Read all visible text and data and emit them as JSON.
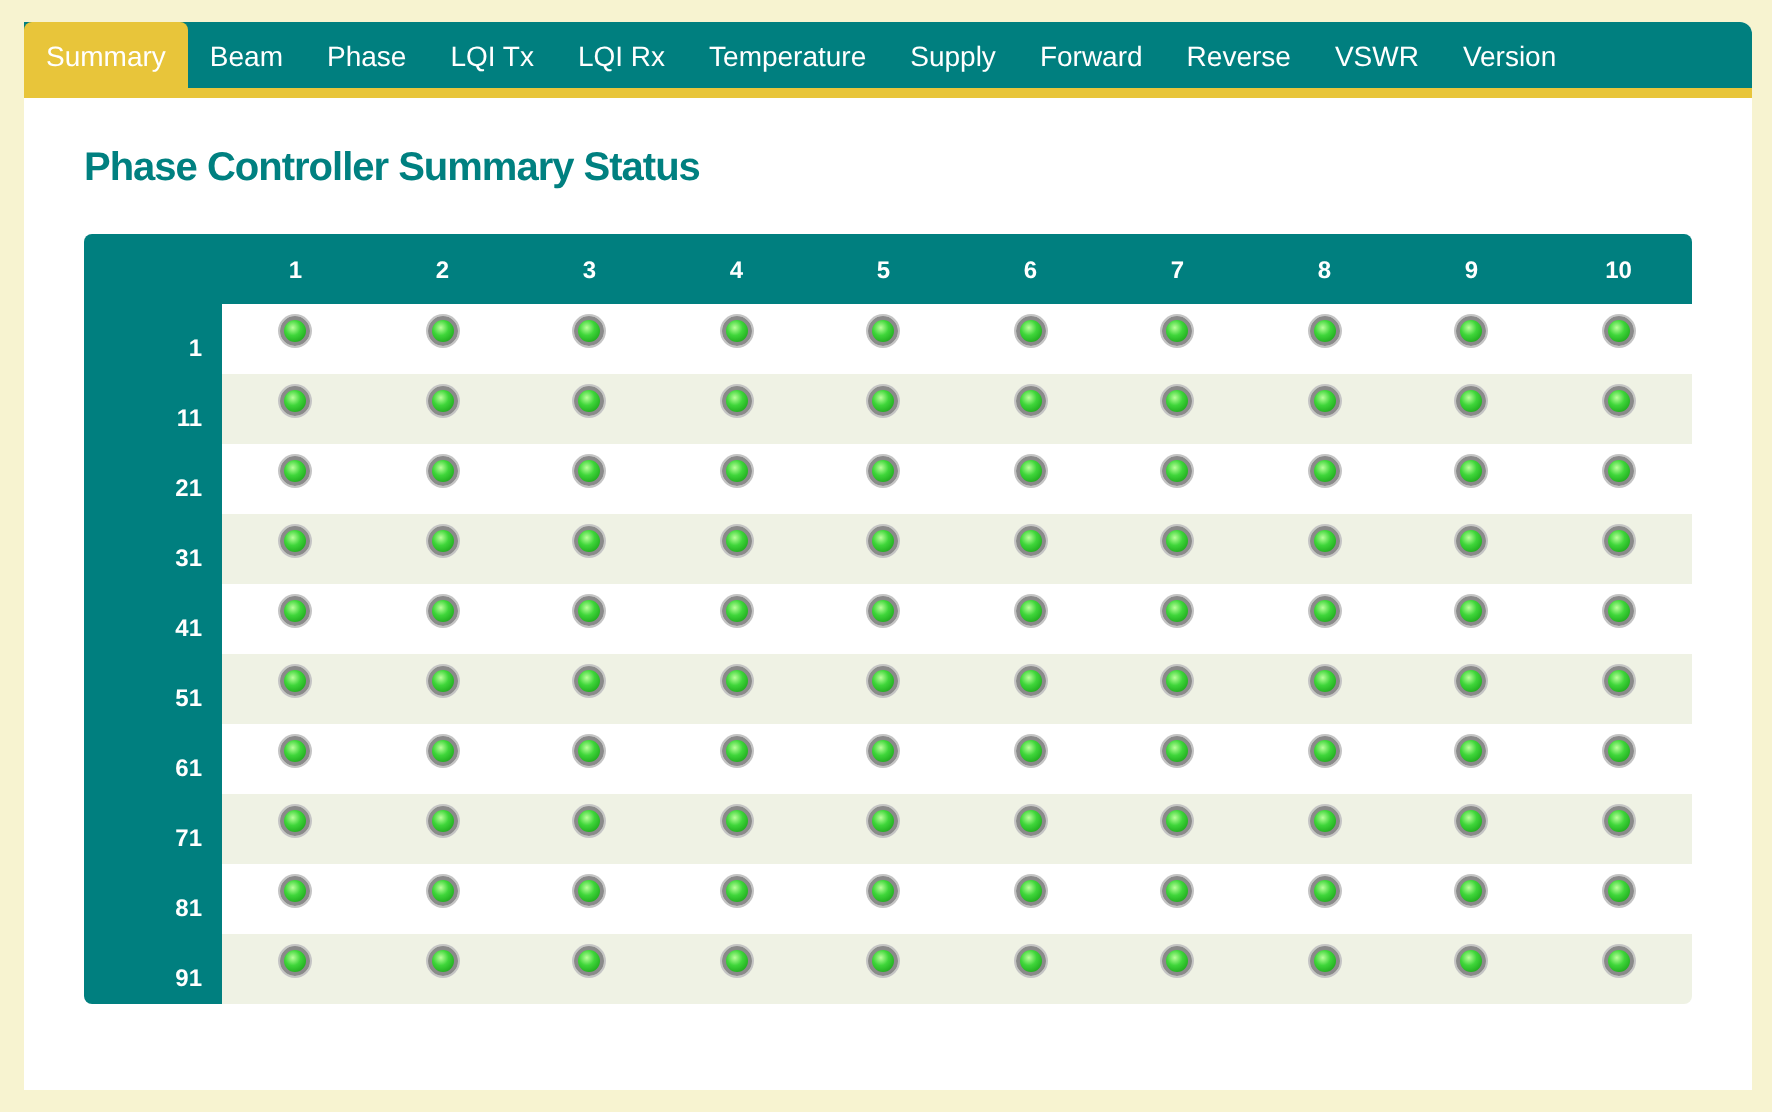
{
  "tabs": [
    {
      "label": "Summary",
      "selected": true
    },
    {
      "label": "Beam",
      "selected": false
    },
    {
      "label": "Phase",
      "selected": false
    },
    {
      "label": "LQI Tx",
      "selected": false
    },
    {
      "label": "LQI Rx",
      "selected": false
    },
    {
      "label": "Temperature",
      "selected": false
    },
    {
      "label": "Supply",
      "selected": false
    },
    {
      "label": "Forward",
      "selected": false
    },
    {
      "label": "Reverse",
      "selected": false
    },
    {
      "label": "VSWR",
      "selected": false
    },
    {
      "label": "Version",
      "selected": false
    }
  ],
  "title": "Phase Controller Summary Status",
  "table": {
    "columns": [
      "1",
      "2",
      "3",
      "4",
      "5",
      "6",
      "7",
      "8",
      "9",
      "10"
    ],
    "rows": [
      {
        "label": "1",
        "leds": [
          {
            "on": true
          },
          {
            "on": true
          },
          {
            "on": true
          },
          {
            "on": true
          },
          {
            "on": true
          },
          {
            "on": true
          },
          {
            "on": true
          },
          {
            "on": true
          },
          {
            "on": true
          },
          {
            "on": true
          }
        ]
      },
      {
        "label": "11",
        "leds": [
          {
            "on": true
          },
          {
            "on": true
          },
          {
            "on": true
          },
          {
            "on": true
          },
          {
            "on": true
          },
          {
            "on": true
          },
          {
            "on": true
          },
          {
            "on": true
          },
          {
            "on": true
          },
          {
            "on": true
          }
        ]
      },
      {
        "label": "21",
        "leds": [
          {
            "on": true
          },
          {
            "on": true
          },
          {
            "on": true
          },
          {
            "on": true
          },
          {
            "on": true
          },
          {
            "on": true
          },
          {
            "on": true
          },
          {
            "on": true
          },
          {
            "on": true
          },
          {
            "on": true
          }
        ]
      },
      {
        "label": "31",
        "leds": [
          {
            "on": true
          },
          {
            "on": true
          },
          {
            "on": true
          },
          {
            "on": true
          },
          {
            "on": true
          },
          {
            "on": true
          },
          {
            "on": true
          },
          {
            "on": true
          },
          {
            "on": true
          },
          {
            "on": true
          }
        ]
      },
      {
        "label": "41",
        "leds": [
          {
            "on": true
          },
          {
            "on": true
          },
          {
            "on": true
          },
          {
            "on": true
          },
          {
            "on": true
          },
          {
            "on": true
          },
          {
            "on": true
          },
          {
            "on": true
          },
          {
            "on": true
          },
          {
            "on": true
          }
        ]
      },
      {
        "label": "51",
        "leds": [
          {
            "on": true
          },
          {
            "on": true
          },
          {
            "on": true
          },
          {
            "on": true
          },
          {
            "on": true
          },
          {
            "on": true
          },
          {
            "on": true
          },
          {
            "on": true
          },
          {
            "on": true
          },
          {
            "on": true
          }
        ]
      },
      {
        "label": "61",
        "leds": [
          {
            "on": true
          },
          {
            "on": true
          },
          {
            "on": true
          },
          {
            "on": true
          },
          {
            "on": true
          },
          {
            "on": true
          },
          {
            "on": true
          },
          {
            "on": true
          },
          {
            "on": true
          },
          {
            "on": true
          }
        ]
      },
      {
        "label": "71",
        "leds": [
          {
            "on": true
          },
          {
            "on": true
          },
          {
            "on": true
          },
          {
            "on": true
          },
          {
            "on": true
          },
          {
            "on": true
          },
          {
            "on": true
          },
          {
            "on": true
          },
          {
            "on": true
          },
          {
            "on": true
          }
        ]
      },
      {
        "label": "81",
        "leds": [
          {
            "on": true
          },
          {
            "on": true
          },
          {
            "on": true
          },
          {
            "on": true
          },
          {
            "on": true
          },
          {
            "on": true
          },
          {
            "on": true
          },
          {
            "on": true
          },
          {
            "on": true
          },
          {
            "on": true
          }
        ]
      },
      {
        "label": "91",
        "leds": [
          {
            "on": true
          },
          {
            "on": true
          },
          {
            "on": true
          },
          {
            "on": true
          },
          {
            "on": true
          },
          {
            "on": true
          },
          {
            "on": true
          },
          {
            "on": true
          },
          {
            "on": true
          },
          {
            "on": true
          }
        ]
      }
    ]
  }
}
